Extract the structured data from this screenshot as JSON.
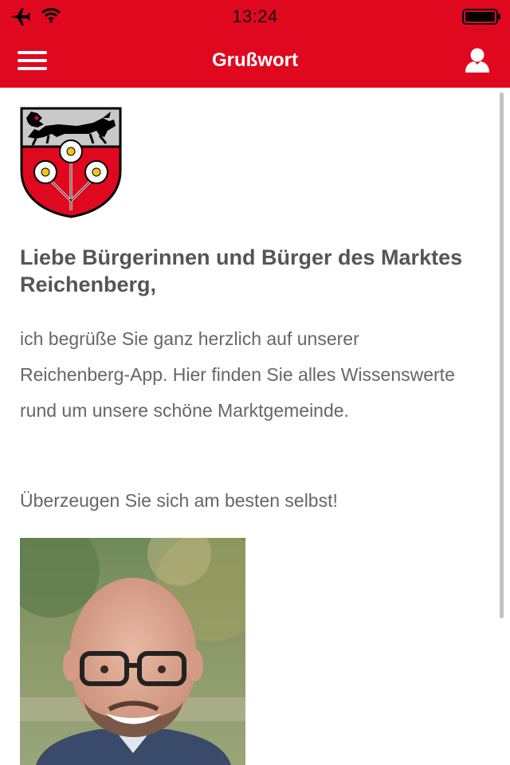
{
  "status_bar": {
    "time": "13:24",
    "icons": [
      "airplane-icon",
      "wifi-icon",
      "battery-icon"
    ]
  },
  "nav": {
    "title": "Grußwort",
    "left_icon": "hamburger-menu-icon",
    "right_icon": "user-icon"
  },
  "content": {
    "heading": "Liebe Bürgerinnen und Bürger des Marktes Reichenberg,",
    "paragraph1": "ich begrüße Sie ganz herzlich auf unserer Reichenberg-App. Hier finden Sie alles Wissenswerte rund um unsere schöne Marktgemeinde.",
    "paragraph2": "Überzeugen Sie sich am besten selbst!"
  },
  "colors": {
    "brand_red": "#e0081f",
    "text_heading": "#555555",
    "text_body": "#666666"
  }
}
